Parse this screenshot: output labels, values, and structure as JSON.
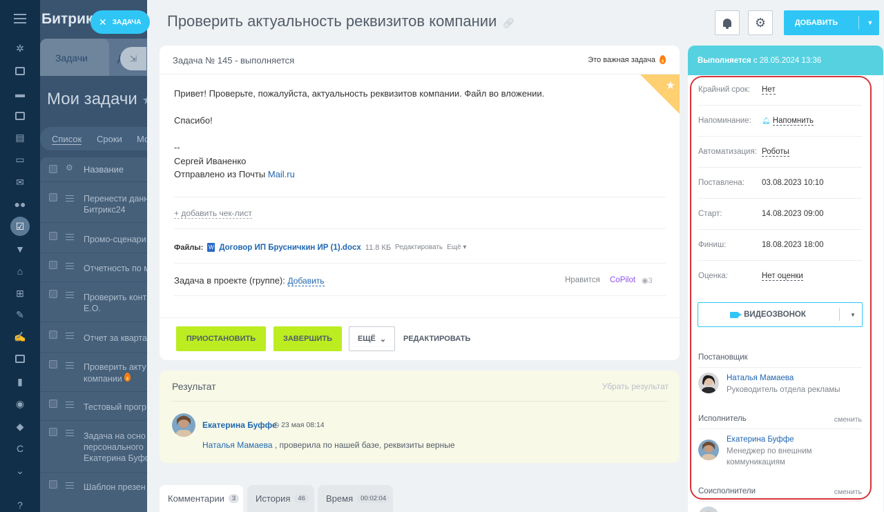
{
  "portal": {
    "logo": "Битрикс",
    "close_label": "ЗАДАЧА",
    "tab_tasks": "Задачи",
    "tab_d": "Д",
    "title": "Мои задачи",
    "view_tabs": [
      "Список",
      "Сроки",
      "Мо"
    ],
    "col_name": "Название",
    "rows": [
      [
        "Перенести данн",
        "Битрикс24"
      ],
      [
        "Промо-сценари"
      ],
      [
        "Отчетность по м"
      ],
      [
        "Проверить конт",
        "Е.О."
      ],
      [
        "Отчет за кварта"
      ],
      [
        "Проверить акту",
        "компании"
      ],
      [
        "Тестовый прогр"
      ],
      [
        "Задача на осно",
        "персонального",
        "Екатерина Буфф"
      ],
      [
        "Шаблон презен"
      ]
    ]
  },
  "task": {
    "title": "Проверить актуальность реквизитов компании",
    "number_status": "Задача № 145 - выполняется",
    "important": "Это важная задача",
    "description": {
      "line1": "Привет! Проверьте, пожалуйста, актуальность реквизитов компании. Файл во вложении.",
      "line2": "Спасибо!",
      "line3": "--",
      "line4": "Сергей Иваненко",
      "line5_prefix": "Отправлено из Почты ",
      "line5_link": "Mail.ru"
    },
    "add_checklist": "+ добавить чек-лист",
    "files_label": "Файлы:",
    "file_name": "Договор ИП Брусничкин ИР (1).docx",
    "file_size": "11.8 КБ",
    "file_edit": "Редактировать",
    "file_more": "Ещё",
    "project_label": "Задача в проекте (группе):",
    "project_add": "Добавить",
    "likes": "Нравится",
    "copilot": "CoPilot",
    "views": "3",
    "buttons": {
      "pause": "ПРИОСТАНОВИТЬ",
      "finish": "ЗАВЕРШИТЬ",
      "more": "ЕЩЁ",
      "edit": "РЕДАКТИРОВАТЬ"
    }
  },
  "header": {
    "add": "ДОБАВИТЬ"
  },
  "result": {
    "title": "Результат",
    "remove": "Убрать результат",
    "author": "Екатерина Буффе",
    "time": "23 мая 08:14",
    "mention": "Наталья Мамаева",
    "text": " , проверила по нашей базе, реквизиты верные"
  },
  "bottom_tabs": [
    {
      "label": "Комментарии",
      "count": "3"
    },
    {
      "label": "История",
      "count": "46"
    },
    {
      "label": "Время",
      "count": "00:02:04"
    }
  ],
  "sidebar": {
    "status": "Выполняется",
    "status_date": "с 28.05.2024 13:36",
    "rows": [
      {
        "k": "Крайний срок:",
        "v": "Нет"
      },
      {
        "k": "Напоминание:",
        "v": "Напомнить"
      },
      {
        "k": "Автоматизация:",
        "v": "Роботы"
      },
      {
        "k": "Поставлена:",
        "v": "03.08.2023 10:10"
      },
      {
        "k": "Старт:",
        "v": "14.08.2023 09:00"
      },
      {
        "k": "Финиш:",
        "v": "18.08.2023 18:00"
      },
      {
        "k": "Оценка:",
        "v": "Нет оценки"
      }
    ],
    "videocall": "ВИДЕОЗВОНОК",
    "creator_label": "Постановщик",
    "creator_name": "Наталья Мамаева",
    "creator_role": "Руководитель отдела рекламы",
    "assignee_label": "Исполнитель",
    "change": "сменить",
    "assignee_name": "Екатерина Буффе",
    "assignee_role_1": "Менеджер по внешним",
    "assignee_role_2": "коммуникациям",
    "coassignees_label": "Соисполнители"
  },
  "colors": {
    "accent": "#2fc6f6",
    "green_button": "#bbed21",
    "status_bar": "#56d1e0",
    "highlight_frame": "#d9323c",
    "link": "#2067b0"
  }
}
